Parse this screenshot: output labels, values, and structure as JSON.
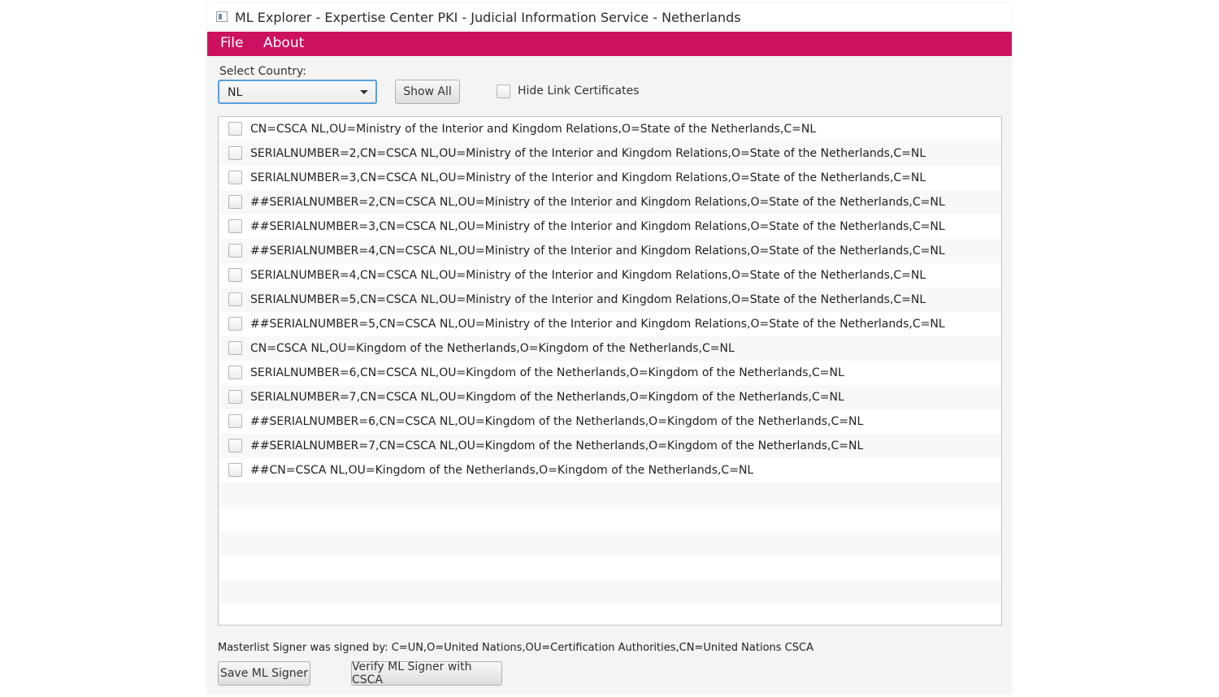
{
  "window": {
    "title": "ML Explorer - Expertise Center PKI - Judicial Information Service - Netherlands"
  },
  "menu": {
    "file": "File",
    "about": "About"
  },
  "country": {
    "label": "Select Country:",
    "selected": "NL"
  },
  "toolbar": {
    "show_all": "Show All",
    "hide_link_label": "Hide Link Certificates"
  },
  "certificates": [
    "CN=CSCA NL,OU=Ministry of the Interior and Kingdom Relations,O=State of the Netherlands,C=NL",
    "SERIALNUMBER=2,CN=CSCA NL,OU=Ministry of the Interior and Kingdom Relations,O=State of the Netherlands,C=NL",
    "SERIALNUMBER=3,CN=CSCA NL,OU=Ministry of the Interior and Kingdom Relations,O=State of the Netherlands,C=NL",
    "##SERIALNUMBER=2,CN=CSCA NL,OU=Ministry of the Interior and Kingdom Relations,O=State of the Netherlands,C=NL",
    "##SERIALNUMBER=3,CN=CSCA NL,OU=Ministry of the Interior and Kingdom Relations,O=State of the Netherlands,C=NL",
    "##SERIALNUMBER=4,CN=CSCA NL,OU=Ministry of the Interior and Kingdom Relations,O=State of the Netherlands,C=NL",
    "SERIALNUMBER=4,CN=CSCA NL,OU=Ministry of the Interior and Kingdom Relations,O=State of the Netherlands,C=NL",
    "SERIALNUMBER=5,CN=CSCA NL,OU=Ministry of the Interior and Kingdom Relations,O=State of the Netherlands,C=NL",
    "##SERIALNUMBER=5,CN=CSCA NL,OU=Ministry of the Interior and Kingdom Relations,O=State of the Netherlands,C=NL",
    "CN=CSCA NL,OU=Kingdom of the Netherlands,O=Kingdom of the Netherlands,C=NL",
    "SERIALNUMBER=6,CN=CSCA NL,OU=Kingdom of the Netherlands,O=Kingdom of the Netherlands,C=NL",
    "SERIALNUMBER=7,CN=CSCA NL,OU=Kingdom of the Netherlands,O=Kingdom of the Netherlands,C=NL",
    "##SERIALNUMBER=6,CN=CSCA NL,OU=Kingdom of the Netherlands,O=Kingdom of the Netherlands,C=NL",
    "##SERIALNUMBER=7,CN=CSCA NL,OU=Kingdom of the Netherlands,O=Kingdom of the Netherlands,C=NL",
    "##CN=CSCA NL,OU=Kingdom of the Netherlands,O=Kingdom of the Netherlands,C=NL"
  ],
  "footer": {
    "signer_text": "Masterlist Signer was signed by: C=UN,O=United Nations,OU=Certification Authorities,CN=United Nations CSCA",
    "save_button": "Save ML Signer",
    "verify_button": "Verify ML Signer with CSCA"
  },
  "colors": {
    "accent": "#cc1160",
    "focus": "#5a9fd8"
  },
  "icons": {
    "app": "app-window-icon",
    "dropdown": "chevron-down-icon"
  }
}
